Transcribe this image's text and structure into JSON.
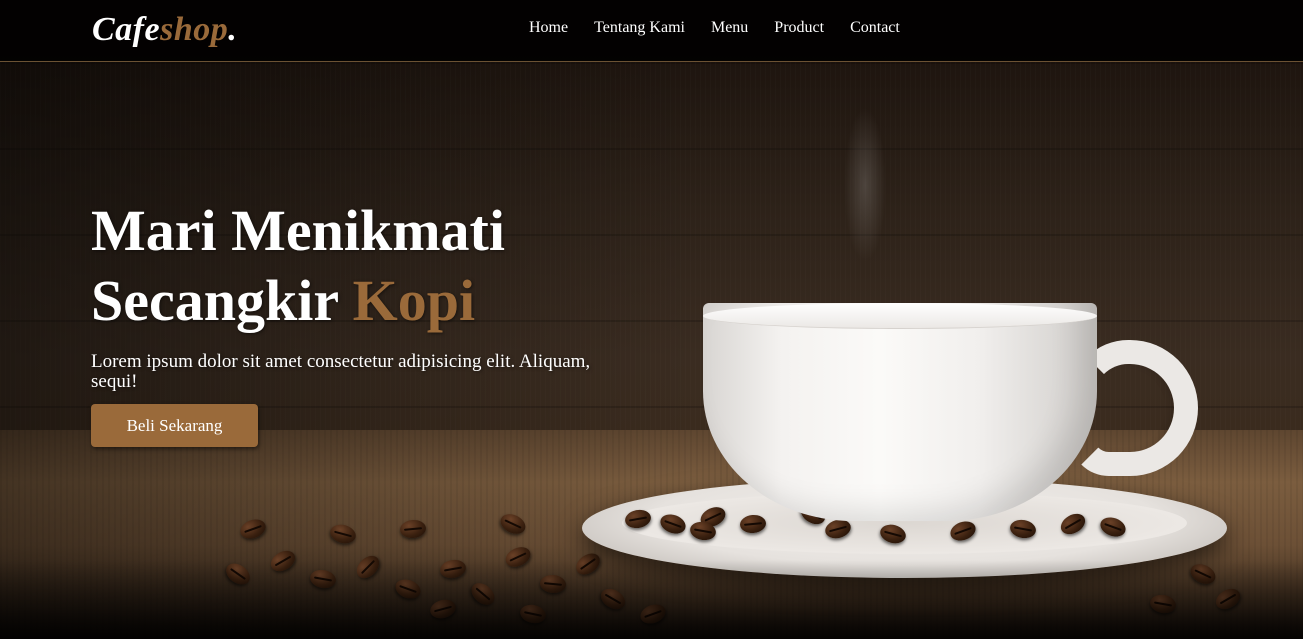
{
  "brand": {
    "logo_main": "Cafe",
    "logo_accent": "shop",
    "logo_dot": "."
  },
  "nav": {
    "items": [
      {
        "label": "Home"
      },
      {
        "label": "Tentang Kami"
      },
      {
        "label": "Menu"
      },
      {
        "label": "Product"
      },
      {
        "label": "Contact"
      }
    ]
  },
  "hero": {
    "headline_line1": "Mari Menikmati",
    "headline_line2_prefix": "Secangkir ",
    "headline_line2_accent": "Kopi",
    "lead": "Lorem ipsum dolor sit amet consectetur adipisicing elit. Aliquam, sequi!",
    "cta_label": "Beli Sekarang",
    "image_alt": "cup-of-coffee-with-beans"
  },
  "colors": {
    "accent": "#9a6a3a",
    "navbar_bg": "#020101",
    "text": "#ffffff"
  }
}
